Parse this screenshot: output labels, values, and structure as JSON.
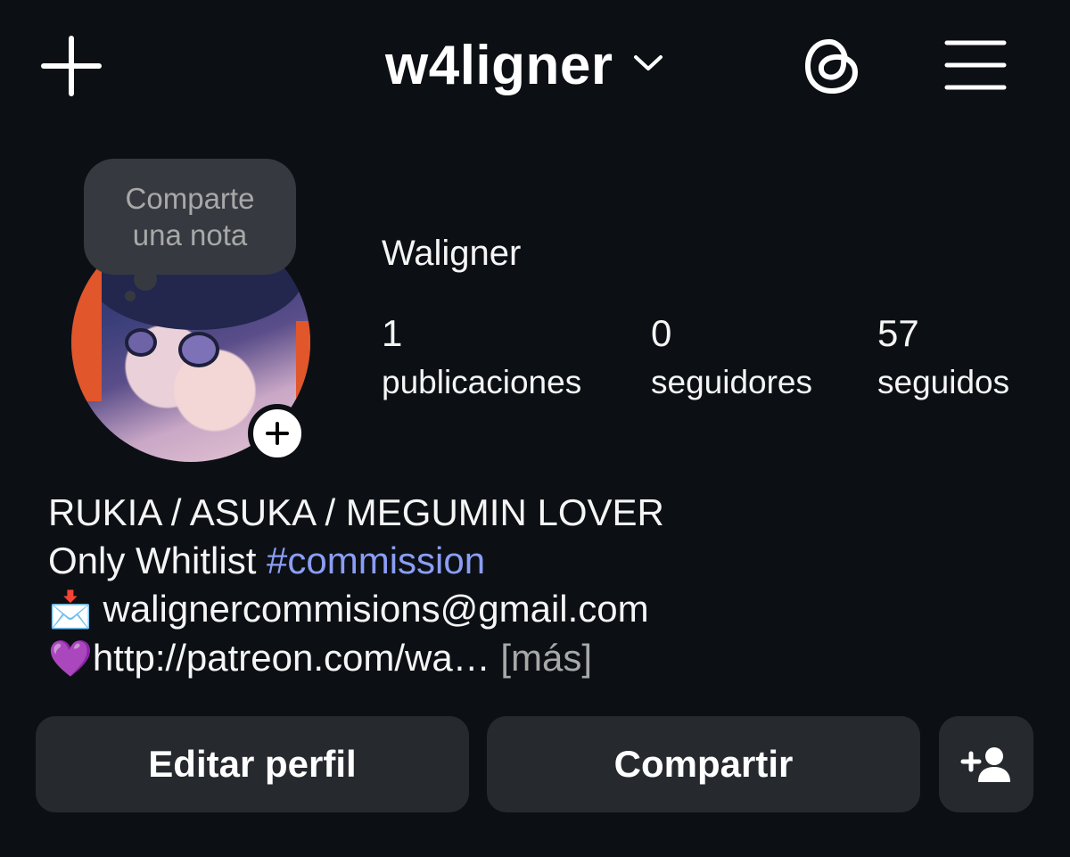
{
  "header": {
    "username": "w4ligner",
    "icons": {
      "create": "plus-icon",
      "switch_account": "chevron-down-icon",
      "threads": "threads-icon",
      "menu": "hamburger-menu-icon"
    }
  },
  "note": {
    "text": "Comparte una nota"
  },
  "profile": {
    "display_name": "Waligner",
    "stats": [
      {
        "value": "1",
        "label": "publicaciones"
      },
      {
        "value": "0",
        "label": "seguidores"
      },
      {
        "value": "57",
        "label": "seguidos"
      }
    ]
  },
  "bio": {
    "line1": "RUKIA / ASUKA / MEGUMIN LOVER",
    "line2_text": "Only Whitlist ",
    "line2_hashtag": "#commission",
    "line3_emoji": "📩",
    "line3_text": " walignercommisions@gmail.com",
    "line4_emoji": "💜",
    "line4_text": "http://patreon.com/wa…",
    "more_label": " [más]"
  },
  "actions": {
    "edit_profile": "Editar perfil",
    "share": "Compartir",
    "add_user_icon": "add-user-icon"
  },
  "colors": {
    "background": "#0c1014",
    "button_bg": "#262a2f",
    "hashtag": "#8b9df5",
    "muted": "#a8a8a8"
  }
}
